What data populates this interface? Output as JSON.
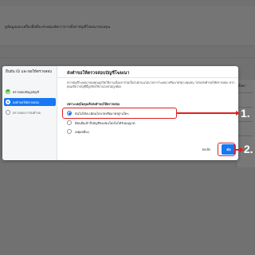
{
  "background": {
    "header_text": "ดูข้อมูลและเครื่องมือที่จะช่วยคุณจัดการการตั้งค่าบัญชีโฆษณาของคุณ",
    "right_card_label": "ตั้งค่า"
  },
  "sidebar": {
    "title": "ยืนยัน ID และขอให้ตรวจสอบ",
    "steps": [
      {
        "label": "ตรวจสอบข้อมูลบัญชี",
        "state": "done"
      },
      {
        "label": "ส่งคำขอให้ตรวจสอบ",
        "state": "active"
      },
      {
        "label": "ตรวจสอบการส่งคำขอ",
        "state": "pending"
      }
    ]
  },
  "dialog": {
    "title": "ส่งคำขอให้ตรวจสอบบัญชีโฆษณา",
    "description": "หากบัญชีโฆษณาของคุณถูกปิดใช้งานเนื่องจากไม่เป็นไปตามนโยบายการโฆษณาหรือมาตรฐานชุมชน โปรดส่งคำขอให้ตรวจสอบ หากคุณเชื่อว่าบัญชีนี้ถูกปิดใช้งานโดยไม่ถูกต้อง",
    "question": "เพราะเหตุใดคุณจึงส่งคำขอให้ตรวจสอบ",
    "options": [
      {
        "label": "ฉันไม่ได้ละเมิดนโยบายหรือมาตรฐานใดๆ",
        "checked": true
      },
      {
        "label": "มีคนอื่นเข้าถึงบัญชีของฉันโดยไม่ได้รับอนุญาต",
        "checked": false
      },
      {
        "label": "เหตุผลอื่นๆ",
        "checked": false
      }
    ],
    "cancel_label": "ยกเลิก",
    "next_label": "ต่อ"
  },
  "callouts": [
    "1.",
    "2."
  ],
  "colors": {
    "accent": "#1877f2",
    "highlight": "#e02020",
    "success": "#42b72a"
  }
}
